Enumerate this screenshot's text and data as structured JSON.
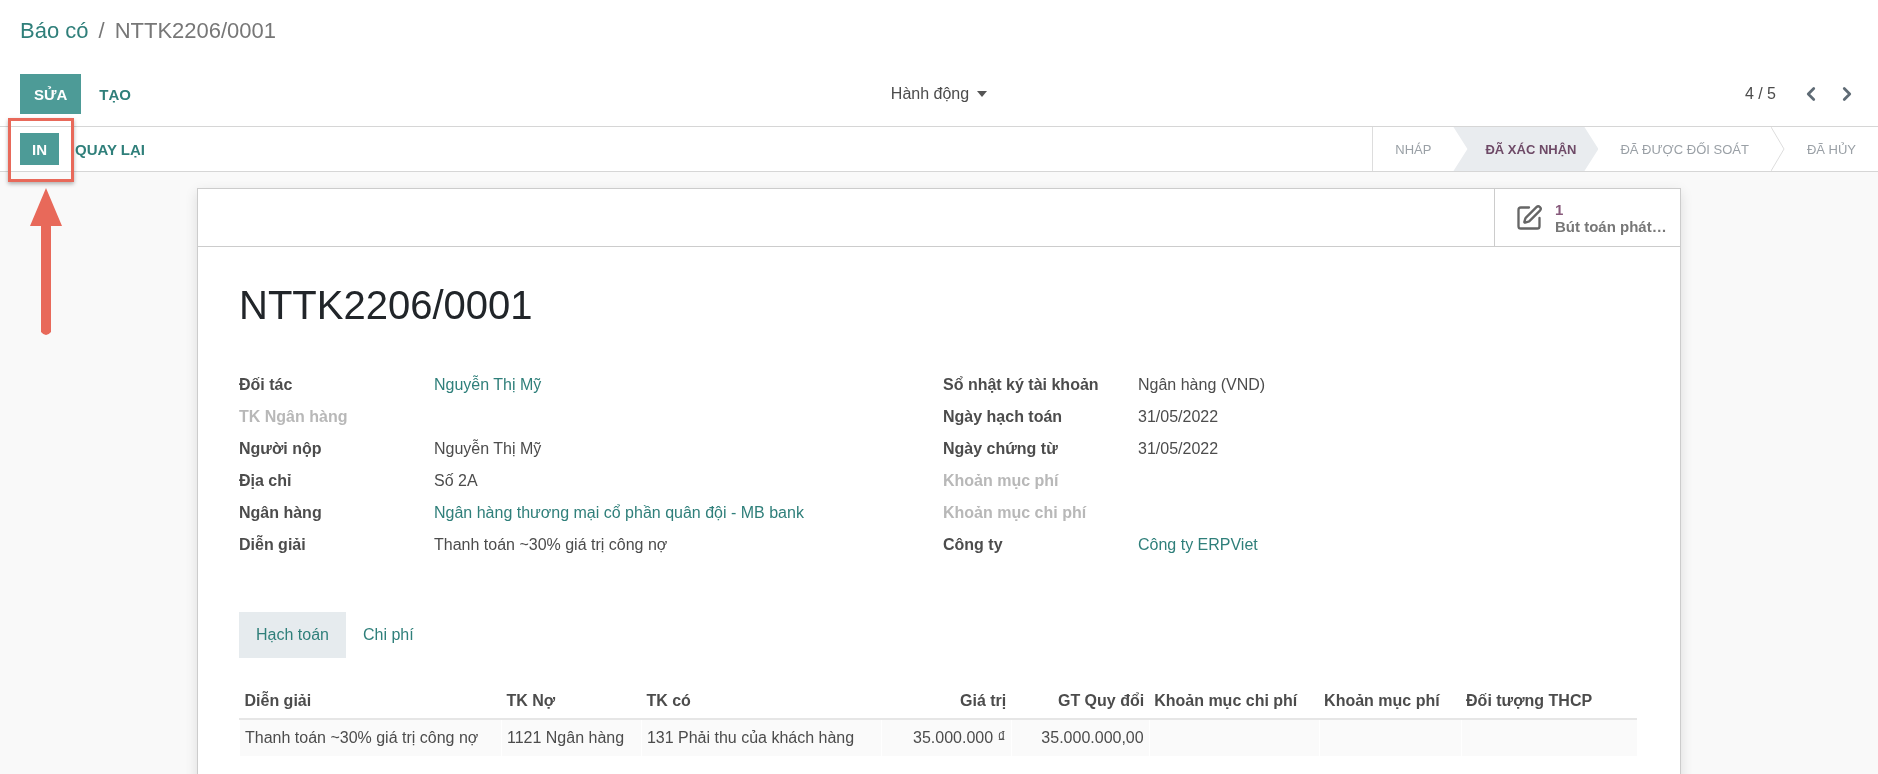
{
  "breadcrumb": [
    {
      "label": "Báo có",
      "kind": "link"
    },
    {
      "label": "/",
      "kind": "separator"
    },
    {
      "label": "NTTK2206/0001",
      "kind": "current"
    }
  ],
  "main_buttons": [
    {
      "label": "SỬA",
      "kind": "primary"
    },
    {
      "label": "TẠO",
      "kind": "secondary"
    }
  ],
  "action_menu": {
    "label": "Hành động"
  },
  "pager": {
    "value": "4 / 5"
  },
  "record_buttons": [
    {
      "label": "IN",
      "kind": "primary"
    },
    {
      "label": "QUAY LẠI",
      "kind": "secondary"
    }
  ],
  "status_stages": [
    {
      "label": "NHÁP",
      "selected": false
    },
    {
      "label": "ĐÃ XÁC NHẬN",
      "selected": true
    },
    {
      "label": "ĐÃ ĐƯỢC ĐỐI SOÁT",
      "selected": false
    },
    {
      "label": "ĐÃ HỦY",
      "selected": false
    }
  ],
  "stat_button": {
    "count": "1",
    "label": "Bút toán phát…"
  },
  "title": "NTTK2206/0001",
  "left_fields": [
    {
      "label": "Đối tác",
      "value": "Nguyễn Thị Mỹ",
      "link": true,
      "muted": false
    },
    {
      "label": "TK Ngân hàng",
      "muted": true
    },
    {
      "label": "Người nộp",
      "value": "Nguyễn Thị Mỹ",
      "link": false,
      "muted": false
    },
    {
      "label": "Địa chỉ",
      "value": "Số 2A",
      "link": false,
      "muted": false
    },
    {
      "label": "Ngân hàng",
      "value": "Ngân hàng thương mại cổ phần quân đội - MB bank",
      "link": true,
      "muted": false
    },
    {
      "label": "Diễn giải",
      "value": "Thanh toán ~30% giá trị công nợ",
      "link": false,
      "muted": false
    }
  ],
  "right_fields": [
    {
      "label": "Sổ nhật ký tài khoản",
      "value": "Ngân hàng (VND)",
      "link": false,
      "muted": false
    },
    {
      "label": "Ngày hạch toán",
      "value": "31/05/2022",
      "link": false,
      "muted": false
    },
    {
      "label": "Ngày chứng từ",
      "value": "31/05/2022",
      "link": false,
      "muted": false
    },
    {
      "label": "Khoản mục phí",
      "muted": true
    },
    {
      "label": "Khoản mục chi phí",
      "muted": true
    },
    {
      "label": "Công ty",
      "value": "Công ty ERPViet",
      "link": true,
      "muted": false
    }
  ],
  "tabs": [
    {
      "label": "Hạch toán",
      "selected": true
    },
    {
      "label": "Chi phí",
      "selected": false
    }
  ],
  "table": {
    "columns": [
      {
        "label": "Diễn giải",
        "kind": "text"
      },
      {
        "label": "TK Nợ",
        "kind": "text"
      },
      {
        "label": "TK có",
        "kind": "text"
      },
      {
        "label": "Giá trị",
        "kind": "amount"
      },
      {
        "label": "GT Quy đổi",
        "kind": "amount"
      },
      {
        "label": "Khoản mục chi phí",
        "kind": "text"
      },
      {
        "label": "Khoản mục phí",
        "kind": "text"
      },
      {
        "label": "Đối tượng THCP",
        "kind": "text"
      }
    ],
    "rows": [
      [
        "Thanh toán ~30% giá trị công nợ",
        "1121 Ngân hàng",
        "131 Phải thu của khách hàng",
        "35.000.000 ₫",
        "35.000.000,00",
        "",
        "",
        ""
      ]
    ]
  }
}
